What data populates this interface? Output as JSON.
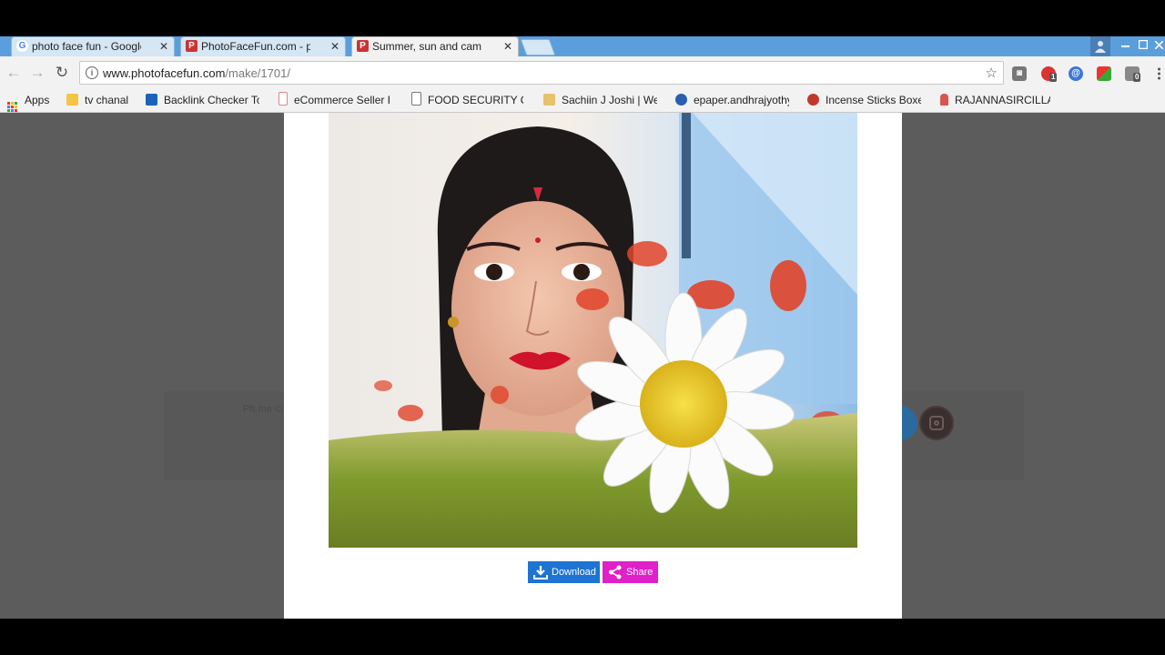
{
  "browser": {
    "tabs": [
      {
        "title": "photo face fun - Google",
        "favicon": "google-icon",
        "active": false
      },
      {
        "title": "PhotoFaceFun.com - pho",
        "favicon": "photofacefun-icon",
        "active": false
      },
      {
        "title": "Summer, sun and camon",
        "favicon": "photofacefun-icon",
        "active": true
      }
    ],
    "close_glyph": "✕",
    "url_host": "www.photofacefun.com",
    "url_path": "/make/1701/",
    "extension_badges": {
      "first": "1",
      "second": "0"
    }
  },
  "bookmarks": [
    {
      "label": "Apps",
      "icon": "apps-grid-icon"
    },
    {
      "label": "tv chanal",
      "icon": "folder-icon"
    },
    {
      "label": "Backlink Checker To",
      "icon": "chart-icon"
    },
    {
      "label": "eCommerce Seller F",
      "icon": "jar-icon"
    },
    {
      "label": "FOOD SECURITY CA",
      "icon": "page-icon"
    },
    {
      "label": "Sachiin J Joshi | Welc",
      "icon": "people-icon"
    },
    {
      "label": "epaper.andhrajyothy",
      "icon": "e-icon"
    },
    {
      "label": "Incense Sticks Boxes",
      "icon": "flower-icon"
    },
    {
      "label": "RAJANNASIRCILLA D",
      "icon": "figure-icon"
    }
  ],
  "page": {
    "footer_text": "Pft.me ©",
    "download_label": "Download",
    "share_label": "Share"
  },
  "colors": {
    "download_button": "#1e74d2",
    "share_button": "#e020c8",
    "tab_strip": "#5a9fdc"
  }
}
